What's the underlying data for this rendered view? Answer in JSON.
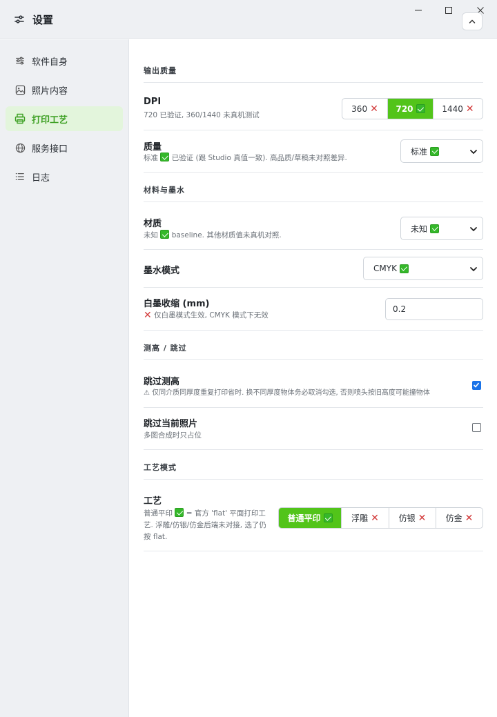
{
  "window": {
    "title": "设置"
  },
  "sidebar": {
    "items": [
      {
        "label": "软件自身",
        "icon": "sliders-icon",
        "active": false
      },
      {
        "label": "照片内容",
        "icon": "image-icon",
        "active": false
      },
      {
        "label": "打印工艺",
        "icon": "printer-icon",
        "active": true
      },
      {
        "label": "服务接口",
        "icon": "globe-icon",
        "active": false
      },
      {
        "label": "日志",
        "icon": "list-icon",
        "active": false
      }
    ]
  },
  "colors": {
    "accent": "#52c41a",
    "ok": "#35b82a",
    "error": "#d23a3a",
    "checkbox": "#1a73e8"
  },
  "sections": {
    "output_quality": "输出质量",
    "material_ink": "材料与墨水",
    "height_skip": "测高 / 跳过",
    "process_mode": "工艺模式"
  },
  "dpi": {
    "title": "DPI",
    "desc": "720 已验证, 360/1440 未真机测试",
    "options": [
      "360",
      "720",
      "1440"
    ],
    "selected": "720"
  },
  "quality": {
    "title": "质量",
    "desc_before": "标准",
    "desc_after": "已验证 (跟 Studio 真值一致). 高品质/草稿未对照差异.",
    "value": "标准"
  },
  "material": {
    "title": "材质",
    "desc_before": "未知",
    "desc_after": "baseline. 其他材质值未真机对照.",
    "value": "未知"
  },
  "ink_mode": {
    "title": "墨水模式",
    "value": "CMYK"
  },
  "white_shrink": {
    "title": "白墨收缩 (mm)",
    "desc": "仅白墨模式生效, CMYK 模式下无效",
    "value": "0.2"
  },
  "skip_height": {
    "title": "跳过测高",
    "desc": "⚠ 仅同介质同厚度重复打印省时. 换不同厚度物体务必取消勾选, 否则喷头按旧高度可能撞物体",
    "checked": true
  },
  "skip_photo": {
    "title": "跳过当前照片",
    "desc": "多图合成时只占位",
    "checked": false
  },
  "process": {
    "title": "工艺",
    "desc_before": "普通平印",
    "desc_after": "= 官方 'flat' 平面打印工艺. 浮雕/仿银/仿金后端未对接, 选了仍按 flat.",
    "options": [
      "普通平印",
      "浮雕",
      "仿银",
      "仿金"
    ],
    "selected": "普通平印"
  }
}
